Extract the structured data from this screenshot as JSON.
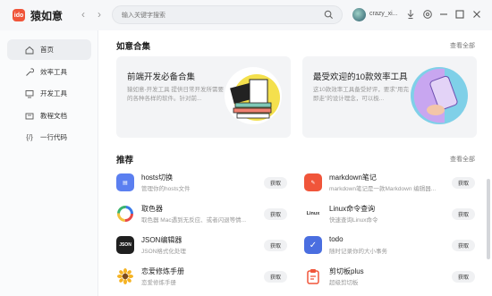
{
  "app": {
    "logo_text": "ido",
    "title": "猿如意"
  },
  "nav": {
    "back": "‹",
    "forward": "›"
  },
  "search": {
    "placeholder": "输入关键字搜索"
  },
  "user": {
    "name": "crazy_xi..."
  },
  "sidebar": {
    "items": [
      {
        "label": "首页",
        "icon": "home-icon"
      },
      {
        "label": "效率工具",
        "icon": "wrench-icon"
      },
      {
        "label": "开发工具",
        "icon": "monitor-icon"
      },
      {
        "label": "教程文档",
        "icon": "document-icon"
      },
      {
        "label": "一行代码",
        "icon": "code-icon"
      }
    ],
    "code_glyph": "{/}"
  },
  "collections": {
    "title": "如意合集",
    "view_all": "查看全部",
    "banners": [
      {
        "title": "前端开发必备合集",
        "desc": "猿如意-开发工具 提供日常开发所需要的各种各样的软件。针对前...",
        "art": "java-script-books"
      },
      {
        "title": "最受欢迎的10款效率工具",
        "desc": "这10款效率工具备受好评，要求\"用完即走\"的设计理念，可以极...",
        "art": "hand-tablet"
      }
    ]
  },
  "recommend": {
    "title": "推荐",
    "view_all": "查看全部",
    "get_label": "获取",
    "items": [
      {
        "name": "hosts切换",
        "desc": "管理你的hosts文件",
        "icon": "hosts-icon",
        "color": "#5b7ff0",
        "glyph": "▤"
      },
      {
        "name": "markdown笔记",
        "desc": "markdown笔记是一款Markdown 编辑器...",
        "icon": "markdown-icon",
        "color": "#f0553a",
        "glyph": "✎"
      },
      {
        "name": "取色器",
        "desc": "取色器 Mac遇到无反应、或者闪退等情...",
        "icon": "color-picker-icon",
        "color": "#ffffff",
        "glyph": ""
      },
      {
        "name": "Linux命令查询",
        "desc": "快速查询Linux命令",
        "icon": "linux-icon",
        "color": "#ffffff",
        "glyph": "Linux"
      },
      {
        "name": "JSON编辑器",
        "desc": "JSON格式化处理",
        "icon": "json-icon",
        "color": "#1f1f1f",
        "glyph": "JSON"
      },
      {
        "name": "todo",
        "desc": "随时记录你的大小事务",
        "icon": "todo-icon",
        "color": "#4a6ee0",
        "glyph": "✓"
      },
      {
        "name": "恋爱修炼手册",
        "desc": "恋爱修炼手册",
        "icon": "sunflower-icon",
        "color": "#ffffff",
        "glyph": "🌻"
      },
      {
        "name": "剪切板plus",
        "desc": "超级剪切板",
        "icon": "clipboard-icon",
        "color": "#ffffff",
        "glyph": ""
      }
    ]
  },
  "colors": {
    "accent": "#f0553a",
    "sidebar_bg": "#fafbfc",
    "banner_bg": "#f3f4f6"
  }
}
